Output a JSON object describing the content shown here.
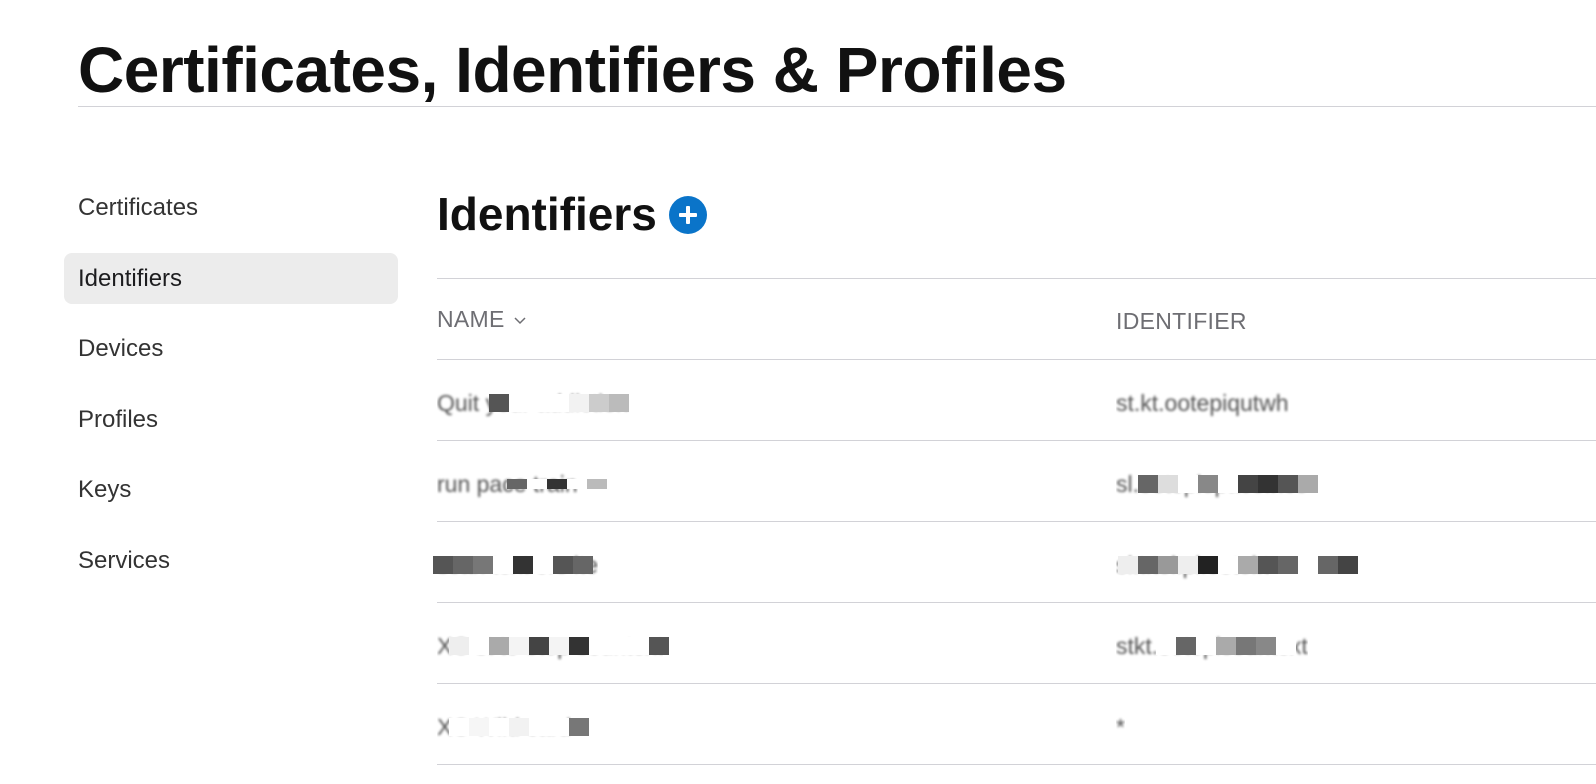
{
  "header": {
    "title": "Certificates, Identifiers & Profiles"
  },
  "sidebar": {
    "items": [
      {
        "label": "Certificates",
        "active": false
      },
      {
        "label": "Identifiers",
        "active": true
      },
      {
        "label": "Devices",
        "active": false
      },
      {
        "label": "Profiles",
        "active": false
      },
      {
        "label": "Keys",
        "active": false
      },
      {
        "label": "Services",
        "active": false
      }
    ]
  },
  "main": {
    "section_title": "Identifiers",
    "add_button_icon": "plus-circle-icon",
    "accent_color": "#0a74c9",
    "table": {
      "columns": {
        "name": "NAME",
        "identifier": "IDENTIFIER"
      },
      "sort_icon": "chevron-down-icon",
      "rows": [
        {
          "name": "Quit your addiction",
          "identifier": "st.kt.ootepiqutwh"
        },
        {
          "name": "run pace train",
          "identifier": "sl.ootopiepace.nce"
        },
        {
          "name": "scan text ors ite",
          "identifier": "sl.t.tol.pl.ootol.t"
        },
        {
          "name": "XC st to otop sountext",
          "identifier": "stkt.ootopisountext"
        },
        {
          "name": "XC Wild card",
          "identifier": "*"
        }
      ]
    }
  }
}
